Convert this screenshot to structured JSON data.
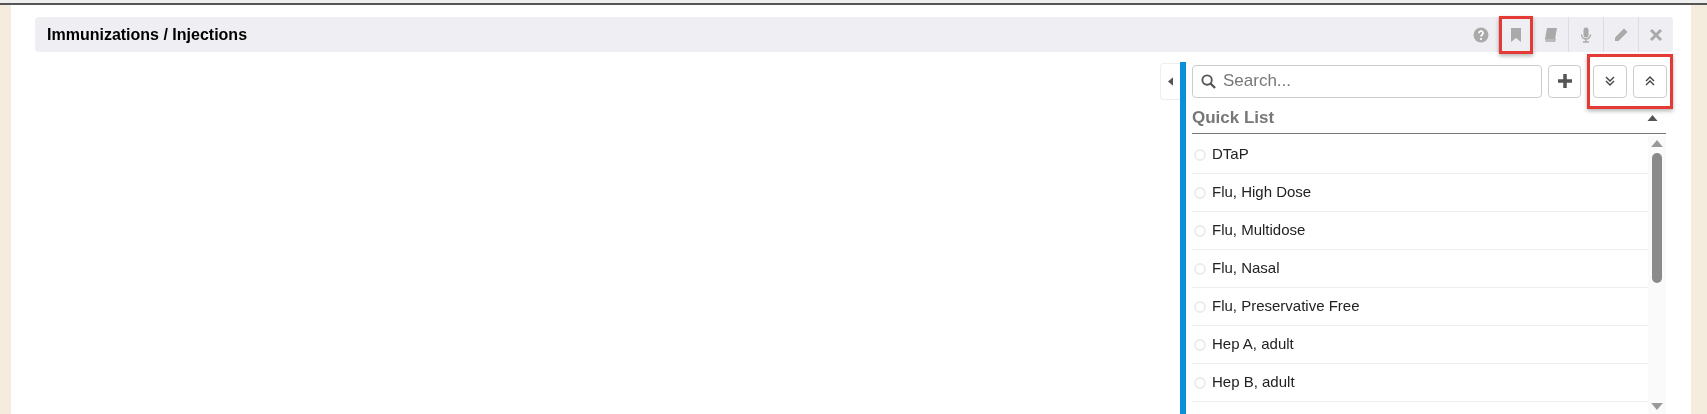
{
  "panel": {
    "title": "Immunizations / Injections",
    "tools": [
      {
        "kind": "help",
        "highlighted": false
      },
      {
        "kind": "bookmark",
        "highlighted": true
      },
      {
        "kind": "book",
        "highlighted": false
      },
      {
        "kind": "mic",
        "highlighted": false
      },
      {
        "kind": "edit",
        "highlighted": false
      },
      {
        "kind": "close",
        "highlighted": false
      }
    ]
  },
  "search": {
    "placeholder": "Search..."
  },
  "expand_controls_highlighted": true,
  "quick_list": {
    "title": "Quick List",
    "items": [
      {
        "label": "DTaP",
        "selected": false
      },
      {
        "label": "Flu, High Dose",
        "selected": false
      },
      {
        "label": "Flu, Multidose",
        "selected": false
      },
      {
        "label": "Flu, Nasal",
        "selected": false
      },
      {
        "label": "Flu, Preservative Free",
        "selected": false
      },
      {
        "label": "Hep A, adult",
        "selected": false
      },
      {
        "label": "Hep B, adult",
        "selected": false
      }
    ]
  }
}
